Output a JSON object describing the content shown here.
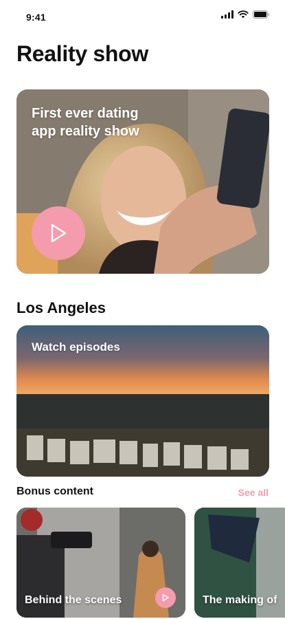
{
  "status_bar": {
    "time": "9:41"
  },
  "page": {
    "title": "Reality show"
  },
  "hero": {
    "title": "First ever dating app reality show"
  },
  "section": {
    "title": "Los Angeles"
  },
  "la_card": {
    "label": "Watch episodes"
  },
  "bonus": {
    "title": "Bonus content",
    "see_all": "See all",
    "cards": [
      {
        "label": "Behind the scenes"
      },
      {
        "label": "The making of"
      }
    ]
  },
  "colors": {
    "accent": "#f49bad",
    "text": "#111111",
    "background": "#ffffff"
  }
}
